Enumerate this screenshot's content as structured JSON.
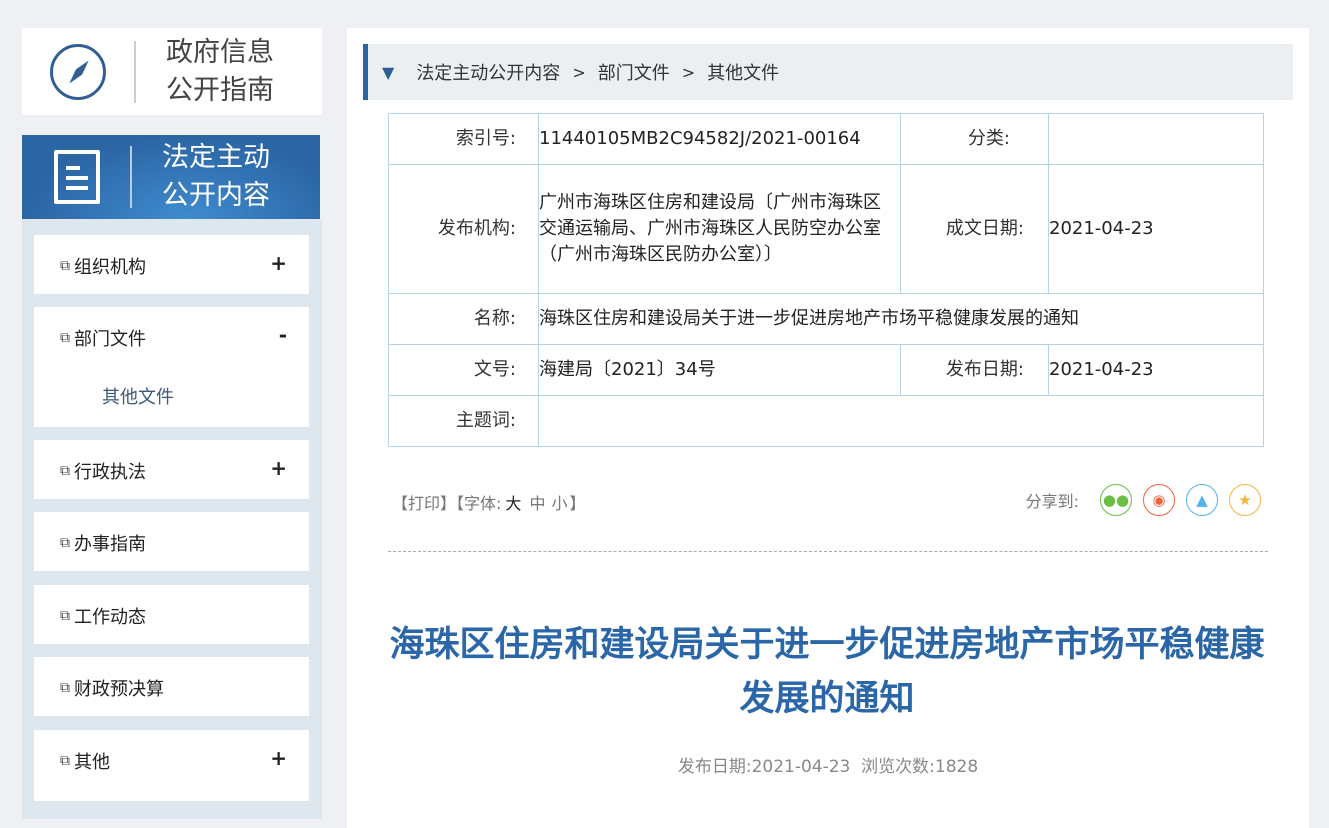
{
  "logo": {
    "title_line1": "政府信息",
    "title_line2": "公开指南"
  },
  "section": {
    "title_line1": "法定主动",
    "title_line2": "公开内容"
  },
  "sidebar": {
    "items": [
      {
        "label": "组织机构",
        "toggle": "+"
      },
      {
        "label": "部门文件",
        "toggle": "-",
        "sub": "其他文件"
      },
      {
        "label": "行政执法",
        "toggle": "+"
      },
      {
        "label": "办事指南",
        "toggle": ""
      },
      {
        "label": "工作动态",
        "toggle": ""
      },
      {
        "label": "财政预决算",
        "toggle": ""
      },
      {
        "label": "其他",
        "toggle": "+"
      }
    ]
  },
  "breadcrumb": [
    "法定主动公开内容",
    "部门文件",
    "其他文件"
  ],
  "info": {
    "index_label": "索引号:",
    "index": "11440105MB2C94582J/2021-00164",
    "category_label": "分类:",
    "category": "",
    "publisher_label": "发布机构:",
    "publisher": "广州市海珠区住房和建设局〔广州市海珠区交通运输局、广州市海珠区人民防空办公室（广州市海珠区民防办公室）〕",
    "created_label": "成文日期:",
    "created": "2021-04-23",
    "name_label": "名称:",
    "name": "海珠区住房和建设局关于进一步促进房地产市场平稳健康发展的通知",
    "docno_label": "文号:",
    "docno": "海建局〔2021〕34号",
    "pubdate_label": "发布日期:",
    "pubdate": "2021-04-23",
    "keywords_label": "主题词:",
    "keywords": ""
  },
  "tools": {
    "print": "【打印】",
    "font_prefix": "【字体:",
    "large": "大",
    "medium": "中",
    "small": "小",
    "font_suffix": "】",
    "share_label": "分享到:"
  },
  "share_colors": {
    "wechat": "#6cbf45",
    "weibo": "#f0643c",
    "qq": "#55b4ea",
    "qzone": "#f7b43c"
  },
  "article": {
    "title": "海珠区住房和建设局关于进一步促进房地产市场平稳健康发展的通知",
    "meta_date_label": "发布日期:",
    "meta_date": "2021-04-23",
    "views_label": "浏览次数:",
    "views": "1828"
  }
}
